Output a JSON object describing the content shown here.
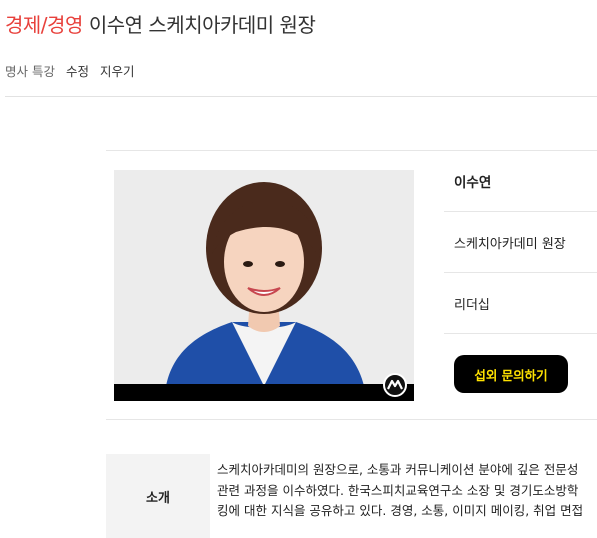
{
  "header": {
    "category": "경제/경영",
    "title": "이수연 스케치아카데미 원장"
  },
  "subnav": {
    "breadcrumb": "명사 특강",
    "edit_label": "수정",
    "delete_label": "지우기"
  },
  "profile": {
    "name": "이수연",
    "affiliation": "스케치아카데미 원장",
    "field": "리더십",
    "inquiry_button": "섭외 문의하기",
    "photo_icon": "speaker-portrait-photo"
  },
  "intro": {
    "label": "소개",
    "lines": [
      "스케치아카데미의 원장으로, 소통과 커뮤니케이션 분야에 깊은 전문성",
      "관련 과정을 이수하였다. 한국스피치교육연구소 소장 및 경기도소방학",
      "킹에 대한 지식을 공유하고 있다. 경영, 소통, 이미지 메이킹, 취업 면접"
    ]
  },
  "colors": {
    "category": "#e8413c",
    "button_bg": "#000000",
    "button_text": "#ffe200"
  }
}
